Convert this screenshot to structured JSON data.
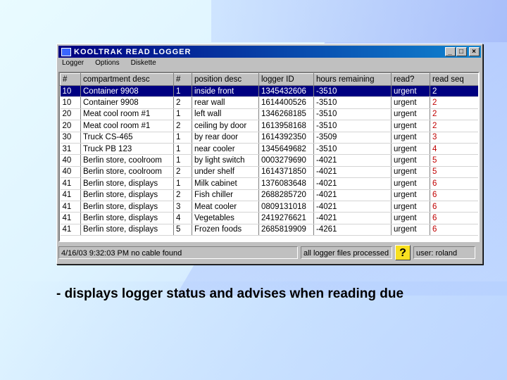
{
  "window": {
    "title": "KOOLTRAK READ LOGGER",
    "controls": {
      "minimize": "_",
      "maximize": "□",
      "close": "×"
    }
  },
  "menu": [
    "Logger",
    "Options",
    "Diskette"
  ],
  "table": {
    "headers": [
      "#",
      "compartment desc",
      "#",
      "position desc",
      "logger ID",
      "hours remaining",
      "read?",
      "read seq"
    ],
    "rows": [
      [
        "10",
        "Container 9908",
        "1",
        "inside front",
        "1345432606",
        "-3510",
        "urgent",
        "2"
      ],
      [
        "10",
        "Container 9908",
        "2",
        "rear wall",
        "1614400526",
        "-3510",
        "urgent",
        "2"
      ],
      [
        "20",
        "Meat cool room #1",
        "1",
        "left wall",
        "1346268185",
        "-3510",
        "urgent",
        "2"
      ],
      [
        "20",
        "Meat cool room #1",
        "2",
        "ceiling by door",
        "1613958168",
        "-3510",
        "urgent",
        "2"
      ],
      [
        "30",
        "Truck CS-465",
        "1",
        "by rear door",
        "1614392350",
        "-3509",
        "urgent",
        "3"
      ],
      [
        "31",
        "Truck PB 123",
        "1",
        "near cooler",
        "1345649682",
        "-3510",
        "urgent",
        "4"
      ],
      [
        "40",
        "Berlin store, coolroom",
        "1",
        "by light switch",
        "0003279690",
        "-4021",
        "urgent",
        "5"
      ],
      [
        "40",
        "Berlin store, coolroom",
        "2",
        "under shelf",
        "1614371850",
        "-4021",
        "urgent",
        "5"
      ],
      [
        "41",
        "Berlin store, displays",
        "1",
        "Milk cabinet",
        "1376083648",
        "-4021",
        "urgent",
        "6"
      ],
      [
        "41",
        "Berlin store, displays",
        "2",
        "Fish chiller",
        "2688285720",
        "-4021",
        "urgent",
        "6"
      ],
      [
        "41",
        "Berlin store, displays",
        "3",
        "Meat cooler",
        "0809131018",
        "-4021",
        "urgent",
        "6"
      ],
      [
        "41",
        "Berlin store, displays",
        "4",
        "Vegetables",
        "2419276621",
        "-4021",
        "urgent",
        "6"
      ],
      [
        "41",
        "Berlin store, displays",
        "5",
        "Frozen foods",
        "2685819909",
        "-4261",
        "urgent",
        "6"
      ]
    ],
    "selected_row": 0
  },
  "status": {
    "left": "4/16/03 9:32:03 PM no cable found",
    "middle": "all logger files processed",
    "help": "?",
    "user": "user: roland"
  },
  "caption": "- displays logger status and advises when reading due",
  "colors": {
    "titlebar": "#000080",
    "selection": "#000080",
    "read_seq": "#c00000",
    "help_button": "#f8e020"
  },
  "icons": [
    "app-icon",
    "help-icon"
  ]
}
